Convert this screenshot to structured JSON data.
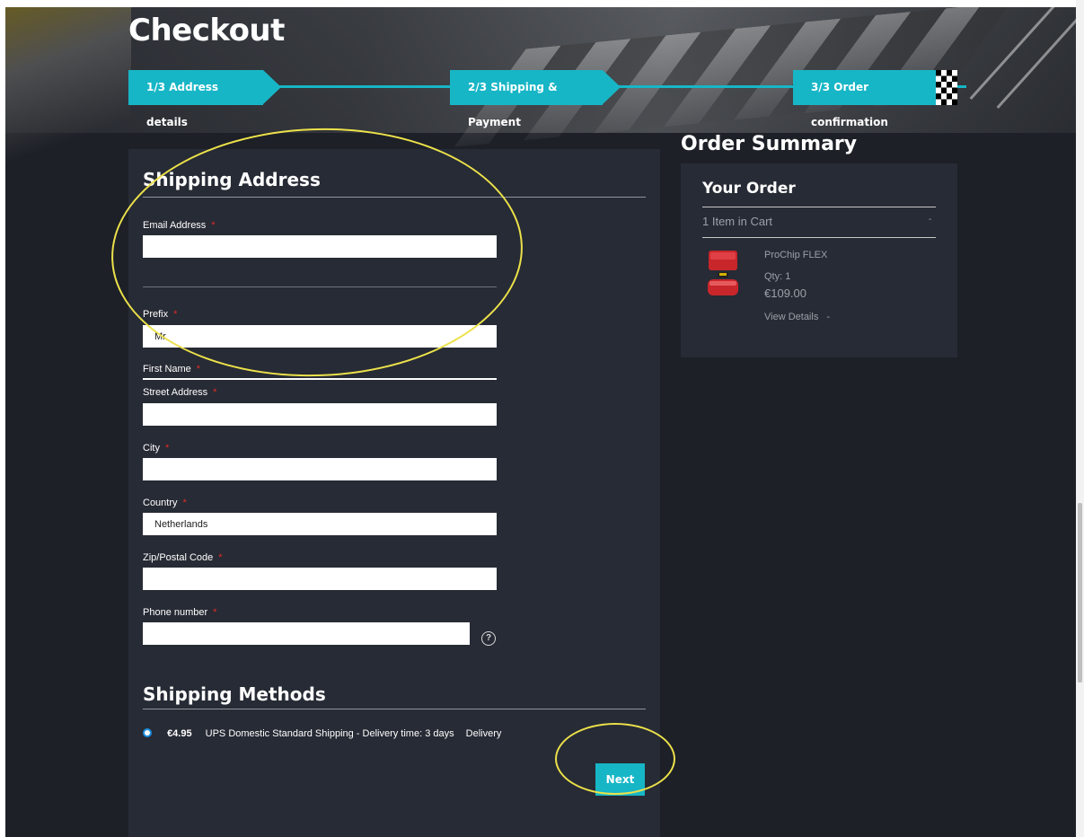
{
  "page": {
    "title": "Checkout"
  },
  "steps": [
    {
      "label": "1/3 Address details"
    },
    {
      "label": "2/3 Shipping & Payment"
    },
    {
      "label": "3/3 Order confirmation"
    }
  ],
  "shipping_address": {
    "title": "Shipping Address",
    "required_marker": "*",
    "email": {
      "label": "Email Address",
      "value": ""
    },
    "prefix": {
      "label": "Prefix",
      "value": "Mr"
    },
    "first_name": {
      "label": "First Name"
    },
    "street": {
      "label": "Street Address",
      "value": ""
    },
    "city": {
      "label": "City",
      "value": ""
    },
    "country": {
      "label": "Country",
      "value": "Netherlands"
    },
    "zip": {
      "label": "Zip/Postal Code",
      "value": ""
    },
    "phone": {
      "label": "Phone number",
      "value": "",
      "help_icon": "question-circle-icon",
      "help_glyph": "?"
    }
  },
  "shipping_methods": {
    "title": "Shipping Methods",
    "options": [
      {
        "price": "€4.95",
        "description": "UPS Domestic Standard Shipping - Delivery time: 3 days",
        "carrier": "Delivery",
        "selected": true
      }
    ]
  },
  "actions": {
    "next_label": "Next"
  },
  "order_summary": {
    "title": "Order Summary",
    "your_order": "Your Order",
    "items_in_cart": "1 Item in Cart",
    "toggle_glyph": "-",
    "item": {
      "name": "ProChip FLEX",
      "qty": "Qty: 1",
      "price": "€109.00",
      "view_details": "View Details",
      "view_details_glyph": "-"
    }
  },
  "colors": {
    "accent": "#17b6c6",
    "panel": "#272b35",
    "required": "#e02b27",
    "annotation": "#ece14a"
  }
}
